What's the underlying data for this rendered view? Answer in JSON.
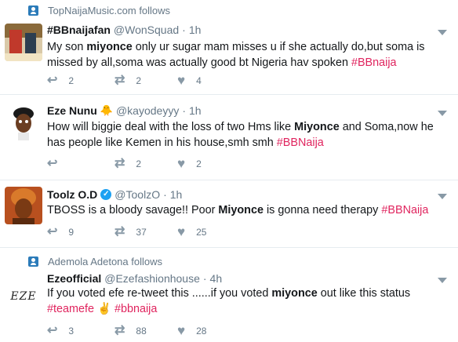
{
  "colors": {
    "accent": "#1da1f2",
    "hashtag": "#e0245e",
    "muted": "#657786",
    "icon": "#8899a6"
  },
  "tweets": [
    {
      "context": "TopNaijaMusic.com follows",
      "name": "#BBnaijafan",
      "handle": "@WonSquad",
      "dot": "·",
      "time": "1h",
      "line1": {
        "a": "My son ",
        "b": "miyonce",
        "c": " only ur sugar mam misses u if she actually do,but soma is"
      },
      "line2": {
        "a": "missed by all,soma was actually good bt Nigeria hav spoken ",
        "tag": "#BBnaija"
      },
      "reply_count": "2",
      "retweet_count": "2",
      "like_count": "4"
    },
    {
      "name": "Eze Nunu",
      "badge_icon": "chick-emoji",
      "handle": "@kayodeyyy",
      "dot": "·",
      "time": "1h",
      "line1": {
        "a": "How will biggie deal with the loss of two Hms like ",
        "b": "Miyonce",
        "c": " and Soma,now he"
      },
      "line2": {
        "a": "has people like Kemen in his house,smh smh ",
        "tag": "#BBNaija"
      },
      "retweet_count": "2",
      "like_count": "2"
    },
    {
      "name": "Toolz O.D",
      "verified": true,
      "handle": "@ToolzO",
      "dot": "·",
      "time": "1h",
      "line1": {
        "a": "TBOSS is a bloody savage!! Poor ",
        "b": "Miyonce",
        "c": " is gonna need therapy ",
        "tag": "#BBNaija"
      },
      "reply_count": "9",
      "retweet_count": "37",
      "like_count": "25"
    },
    {
      "context": "Ademola Adetona follows",
      "name": "Ezeofficial",
      "handle": "@Ezefashionhouse",
      "dot": "·",
      "time": "4h",
      "line1": {
        "a": "If you voted efe re-tweet this ......if you voted ",
        "b": "miyonce",
        "c": " out like this status"
      },
      "line2": {
        "tag": "#teamefe",
        "emoji": " ✌ ",
        "tag2": "#bbnaija"
      },
      "avatar_text": "EZE",
      "reply_count": "3",
      "retweet_count": "88",
      "like_count": "28"
    }
  ]
}
